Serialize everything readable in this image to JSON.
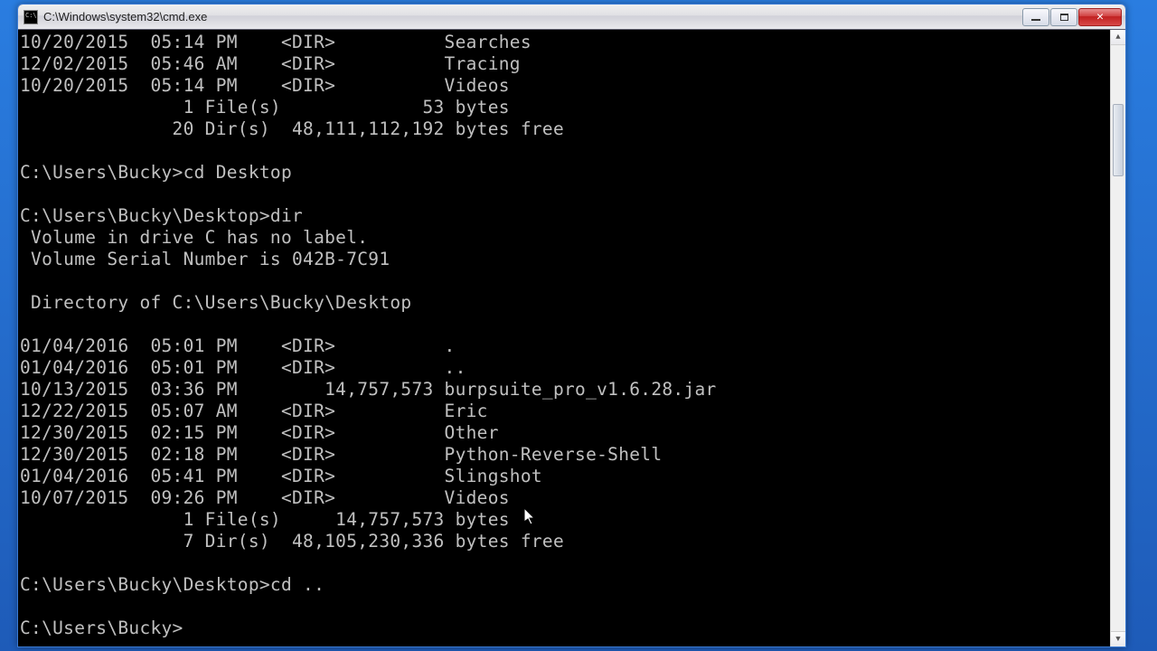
{
  "window": {
    "title": "C:\\Windows\\system32\\cmd.exe",
    "icon_name": "cmd-icon"
  },
  "buttons": {
    "minimize": "minimize",
    "maximize": "maximize",
    "close": "close"
  },
  "terminal": {
    "lines": [
      "10/20/2015  05:14 PM    <DIR>          Searches",
      "12/02/2015  05:46 AM    <DIR>          Tracing",
      "10/20/2015  05:14 PM    <DIR>          Videos",
      "               1 File(s)             53 bytes",
      "              20 Dir(s)  48,111,112,192 bytes free",
      "",
      "C:\\Users\\Bucky>cd Desktop",
      "",
      "C:\\Users\\Bucky\\Desktop>dir",
      " Volume in drive C has no label.",
      " Volume Serial Number is 042B-7C91",
      "",
      " Directory of C:\\Users\\Bucky\\Desktop",
      "",
      "01/04/2016  05:01 PM    <DIR>          .",
      "01/04/2016  05:01 PM    <DIR>          ..",
      "10/13/2015  03:36 PM        14,757,573 burpsuite_pro_v1.6.28.jar",
      "12/22/2015  05:07 AM    <DIR>          Eric",
      "12/30/2015  02:15 PM    <DIR>          Other",
      "12/30/2015  02:18 PM    <DIR>          Python-Reverse-Shell",
      "01/04/2016  05:41 PM    <DIR>          Slingshot",
      "10/07/2015  09:26 PM    <DIR>          Videos",
      "               1 File(s)     14,757,573 bytes",
      "               7 Dir(s)  48,105,230,336 bytes free",
      "",
      "C:\\Users\\Bucky\\Desktop>cd ..",
      "",
      "C:\\Users\\Bucky>"
    ],
    "prompt_cursor": "_"
  }
}
